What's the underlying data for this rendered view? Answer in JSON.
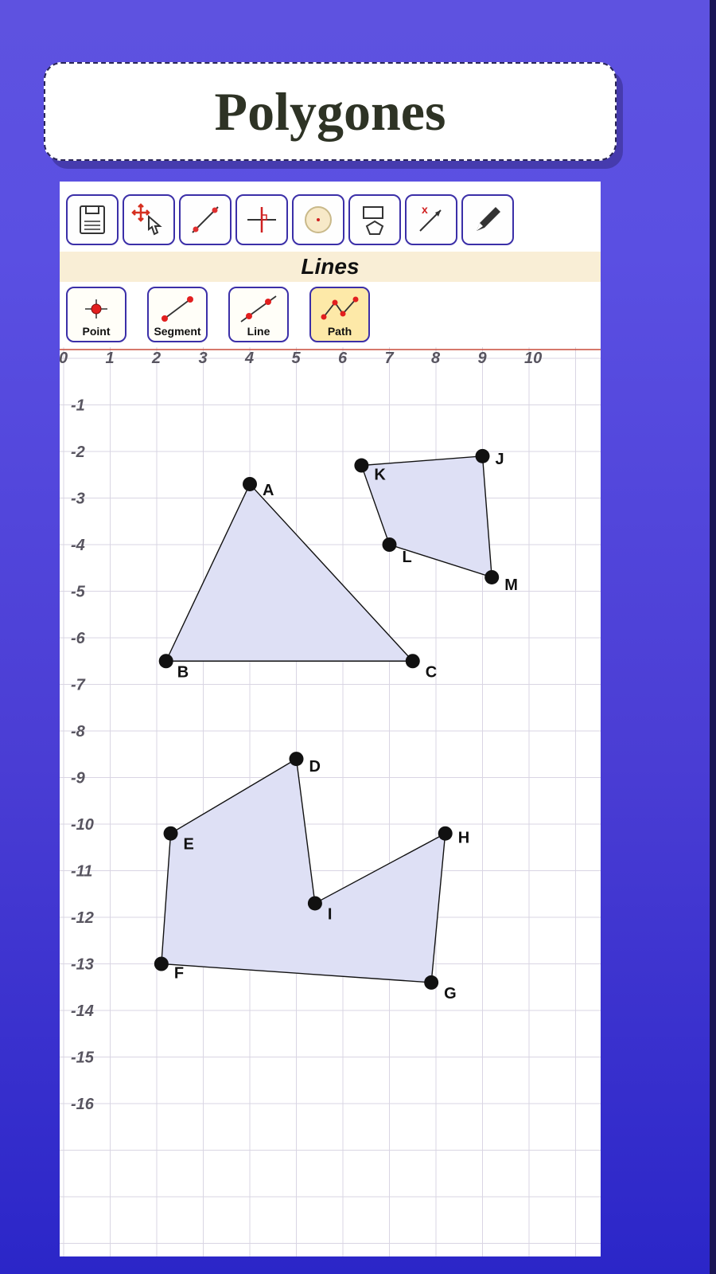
{
  "title": "Polygones",
  "subheader": "Lines",
  "toolbar": [
    {
      "name": "file-icon"
    },
    {
      "name": "move-icon"
    },
    {
      "name": "line-tool-icon"
    },
    {
      "name": "perpendicular-icon"
    },
    {
      "name": "circle-icon"
    },
    {
      "name": "polygon-icon"
    },
    {
      "name": "vector-icon"
    },
    {
      "name": "pen-icon"
    }
  ],
  "subtools": [
    {
      "label": "Point",
      "name": "point-tool"
    },
    {
      "label": "Segment",
      "name": "segment-tool"
    },
    {
      "label": "Line",
      "name": "line-tool"
    },
    {
      "label": "Path",
      "name": "path-tool",
      "active": true
    }
  ],
  "axes": {
    "x_ticks": [
      "0",
      "1",
      "2",
      "3",
      "4",
      "5",
      "6",
      "7",
      "8",
      "9",
      "10"
    ],
    "y_ticks": [
      "-1",
      "-2",
      "-3",
      "-4",
      "-5",
      "-6",
      "-7",
      "-8",
      "-9",
      "-10",
      "-11",
      "-12",
      "-13",
      "-14",
      "-15",
      "-16"
    ]
  },
  "points": {
    "A": {
      "x": 4.0,
      "y": -2.7
    },
    "B": {
      "x": 2.2,
      "y": -6.5
    },
    "C": {
      "x": 7.5,
      "y": -6.5
    },
    "D": {
      "x": 5.0,
      "y": -8.6
    },
    "E": {
      "x": 2.3,
      "y": -10.2
    },
    "F": {
      "x": 2.1,
      "y": -13.0
    },
    "G": {
      "x": 7.9,
      "y": -13.4
    },
    "H": {
      "x": 8.2,
      "y": -10.2
    },
    "I": {
      "x": 5.4,
      "y": -11.7
    },
    "J": {
      "x": 9.0,
      "y": -2.1
    },
    "K": {
      "x": 6.4,
      "y": -2.3
    },
    "L": {
      "x": 7.0,
      "y": -4.0
    },
    "M": {
      "x": 9.2,
      "y": -4.7
    }
  },
  "polygons": [
    [
      "A",
      "B",
      "C"
    ],
    [
      "K",
      "L",
      "M",
      "J"
    ],
    [
      "D",
      "E",
      "F",
      "G",
      "H",
      "I"
    ]
  ]
}
